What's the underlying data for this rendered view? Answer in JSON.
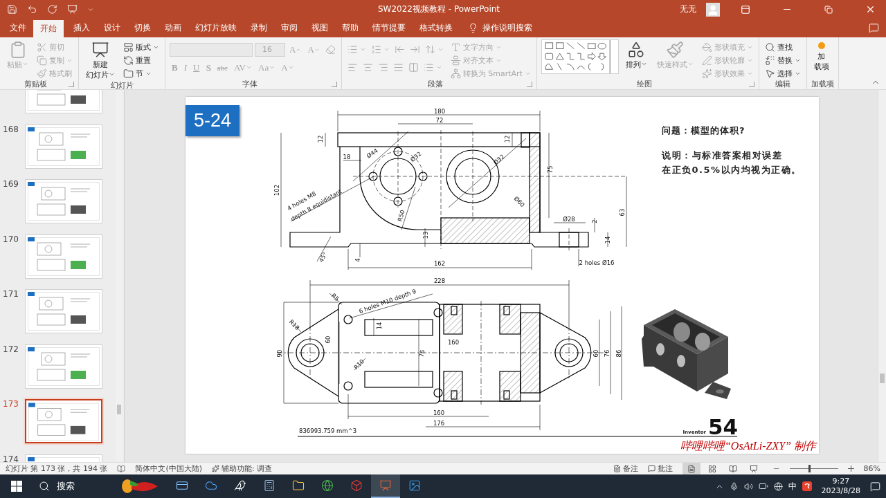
{
  "window": {
    "title": "SW2022视频教程  -  PowerPoint",
    "user": "无无"
  },
  "tabs": [
    {
      "label": "文件",
      "selected": false
    },
    {
      "label": "开始",
      "selected": true
    },
    {
      "label": "插入",
      "selected": false
    },
    {
      "label": "设计",
      "selected": false
    },
    {
      "label": "切换",
      "selected": false
    },
    {
      "label": "动画",
      "selected": false
    },
    {
      "label": "幻灯片放映",
      "selected": false
    },
    {
      "label": "录制",
      "selected": false
    },
    {
      "label": "审阅",
      "selected": false
    },
    {
      "label": "视图",
      "selected": false
    },
    {
      "label": "帮助",
      "selected": false
    },
    {
      "label": "情节提要",
      "selected": false
    },
    {
      "label": "格式转换",
      "selected": false
    }
  ],
  "tell_me": {
    "placeholder": "操作说明搜索"
  },
  "ribbon": {
    "groups": [
      {
        "label": "剪贴板",
        "launcher": true,
        "columns": [
          {
            "items": [
              {
                "kind": "large",
                "label_lines": [
                  "粘贴"
                ],
                "menu": true,
                "disabled": true
              }
            ]
          },
          {
            "items": [
              {
                "kind": "small",
                "label": "剪切",
                "disabled": true
              },
              {
                "kind": "small",
                "label": "复制",
                "menu": true,
                "disabled": true
              },
              {
                "kind": "small",
                "label": "格式刷",
                "disabled": true
              }
            ]
          }
        ]
      },
      {
        "label": "幻灯片",
        "columns": [
          {
            "items": [
              {
                "kind": "large",
                "label_lines": [
                  "新建",
                  "幻灯片"
                ],
                "menu": true,
                "disabled": false
              }
            ]
          },
          {
            "items": [
              {
                "kind": "small",
                "label": "版式",
                "menu": true,
                "disabled": false
              },
              {
                "kind": "small",
                "label": "重置",
                "disabled": false
              },
              {
                "kind": "small",
                "label": "节",
                "menu": true,
                "disabled": false
              }
            ]
          }
        ]
      },
      {
        "label": "字体",
        "launcher": true,
        "columns": [
          {
            "items": [
              {
                "kind": "row",
                "items": [
                  {
                    "kind": "font-field",
                    "disabled": true
                  },
                  {
                    "kind": "size-field",
                    "value": "16",
                    "disabled": true
                  },
                  {
                    "kind": "grow",
                    "label": "A",
                    "disabled": true
                  },
                  {
                    "kind": "shrink",
                    "label": "A",
                    "disabled": true
                  },
                  {
                    "kind": "icon",
                    "disabled": true
                  }
                ]
              },
              {
                "kind": "row",
                "items": [
                  {
                    "kind": "glyph",
                    "label": "B",
                    "disabled": true
                  },
                  {
                    "kind": "glyph",
                    "label": "I",
                    "disabled": true
                  },
                  {
                    "kind": "glyph",
                    "label": "U",
                    "disabled": true
                  },
                  {
                    "kind": "glyph",
                    "label": "S",
                    "disabled": true
                  },
                  {
                    "kind": "glyph",
                    "label": "abc",
                    "disabled": true
                  },
                  {
                    "kind": "glyph",
                    "label": "AV",
                    "menu": true,
                    "disabled": true
                  },
                  {
                    "kind": "glyph",
                    "label": "Aa",
                    "menu": true,
                    "disabled": true
                  },
                  {
                    "kind": "glyph",
                    "label": "A",
                    "menu": true,
                    "disabled": true
                  }
                ]
              }
            ]
          }
        ]
      },
      {
        "label": "段落",
        "launcher": true,
        "columns": [
          {
            "items": [
              {
                "kind": "row",
                "items": [
                  {
                    "kind": "icon",
                    "menu": true,
                    "disabled": true
                  },
                  {
                    "kind": "icon",
                    "menu": true,
                    "disabled": true
                  },
                  {
                    "kind": "icon",
                    "disabled": true
                  },
                  {
                    "kind": "icon",
                    "disabled": true
                  },
                  {
                    "kind": "icon",
                    "menu": true,
                    "disabled": true
                  }
                ]
              },
              {
                "kind": "row",
                "items": [
                  {
                    "kind": "icon",
                    "disabled": true
                  },
                  {
                    "kind": "icon",
                    "disabled": true
                  },
                  {
                    "kind": "icon",
                    "disabled": true
                  },
                  {
                    "kind": "icon",
                    "disabled": true
                  },
                  {
                    "kind": "icon",
                    "disabled": true
                  },
                  {
                    "kind": "icon",
                    "menu": true,
                    "disabled": true
                  }
                ]
              }
            ]
          },
          {
            "items": [
              {
                "kind": "small",
                "label": "文字方向",
                "menu": true,
                "disabled": true
              },
              {
                "kind": "small",
                "label": "对齐文本",
                "menu": true,
                "disabled": true
              },
              {
                "kind": "small",
                "label": "转换为 SmartArt",
                "menu": true,
                "disabled": true
              }
            ]
          }
        ]
      },
      {
        "label": "绘图",
        "launcher": true,
        "columns": [
          {
            "items": [
              {
                "kind": "gallery"
              }
            ]
          },
          {
            "items": [
              {
                "kind": "large",
                "label_lines": [
                  "排列"
                ],
                "menu": true,
                "disabled": false
              }
            ]
          },
          {
            "items": [
              {
                "kind": "large",
                "label_lines": [
                  "快速样式"
                ],
                "menu": true,
                "disabled": true
              }
            ]
          },
          {
            "items": [
              {
                "kind": "small",
                "label": "形状填充",
                "menu": true,
                "disabled": true
              },
              {
                "kind": "small",
                "label": "形状轮廓",
                "menu": true,
                "disabled": true
              },
              {
                "kind": "small",
                "label": "形状效果",
                "menu": true,
                "disabled": true
              }
            ]
          }
        ]
      },
      {
        "label": "编辑",
        "columns": [
          {
            "items": [
              {
                "kind": "small",
                "label": "查找",
                "disabled": false
              },
              {
                "kind": "small",
                "label": "替换",
                "menu": true,
                "disabled": false
              },
              {
                "kind": "small",
                "label": "选择",
                "menu": true,
                "disabled": false
              }
            ]
          }
        ]
      },
      {
        "label": "加载项",
        "columns": [
          {
            "items": [
              {
                "kind": "large",
                "label_lines": [
                  "加",
                  "载项"
                ],
                "disabled": false
              }
            ]
          }
        ]
      }
    ]
  },
  "thumbnails": [
    {
      "selected": false
    },
    {
      "number": "168",
      "selected": false
    },
    {
      "number": "169",
      "selected": false
    },
    {
      "number": "170",
      "selected": false
    },
    {
      "number": "171",
      "selected": false
    },
    {
      "number": "172",
      "selected": false
    },
    {
      "number": "173",
      "selected": true
    },
    {
      "number": "174",
      "selected": false
    }
  ],
  "slide": {
    "badge": "5-24",
    "question": "问题：模型的体积?",
    "note_lines": [
      "说明：与标准答案相对误差",
      "在正负0.5%以内均视为正确。"
    ],
    "front_view_dimensions": [
      "180",
      "72",
      "12",
      "12",
      "18",
      "Ø44",
      "Ø32",
      "Ø32",
      "102",
      "4 holes M8",
      "depth 8 equidistant",
      "R50",
      "Ø60",
      "75",
      "63",
      "Ø28",
      "2",
      "13",
      "14",
      "45°",
      "4",
      "162",
      "2 holes Ø16"
    ],
    "top_view_dimensions": [
      "228",
      "R5",
      "6 holes M10 depth 9",
      "R18",
      "14",
      "60",
      "90",
      "160",
      "75",
      "R10",
      "60",
      "76",
      "86",
      "160",
      "176"
    ],
    "volume": "836993.759 mm^3",
    "software": "Inventor",
    "number": "54",
    "credit": "哔哩哔哩“OsAtLi-ZXY” 制作"
  },
  "status_bar": {
    "slide_info": "幻灯片 第 173 张，共 194 张",
    "language": "简体中文(中国大陆)",
    "accessibility": "辅助功能: 调查",
    "notes": "备注",
    "comments": "批注",
    "views": [
      {
        "selected": true
      },
      {
        "selected": false
      },
      {
        "selected": false
      },
      {
        "selected": false
      }
    ],
    "zoom": {
      "level": 0.4,
      "reading": "86%"
    }
  },
  "taskbar": {
    "search": {
      "placeholder": "搜索"
    },
    "apps": [
      {
        "kind": "card",
        "selected": false
      },
      {
        "kind": "cloud",
        "selected": false
      },
      {
        "kind": "bird",
        "selected": false
      },
      {
        "kind": "calculator",
        "selected": false
      },
      {
        "kind": "folder",
        "selected": false
      },
      {
        "kind": "browser",
        "selected": false
      },
      {
        "kind": "cad",
        "selected": false
      },
      {
        "kind": "slides",
        "selected": true
      },
      {
        "kind": "photos",
        "selected": false
      }
    ],
    "ime": "中",
    "time": "9:27",
    "date": "2023/8/28"
  }
}
